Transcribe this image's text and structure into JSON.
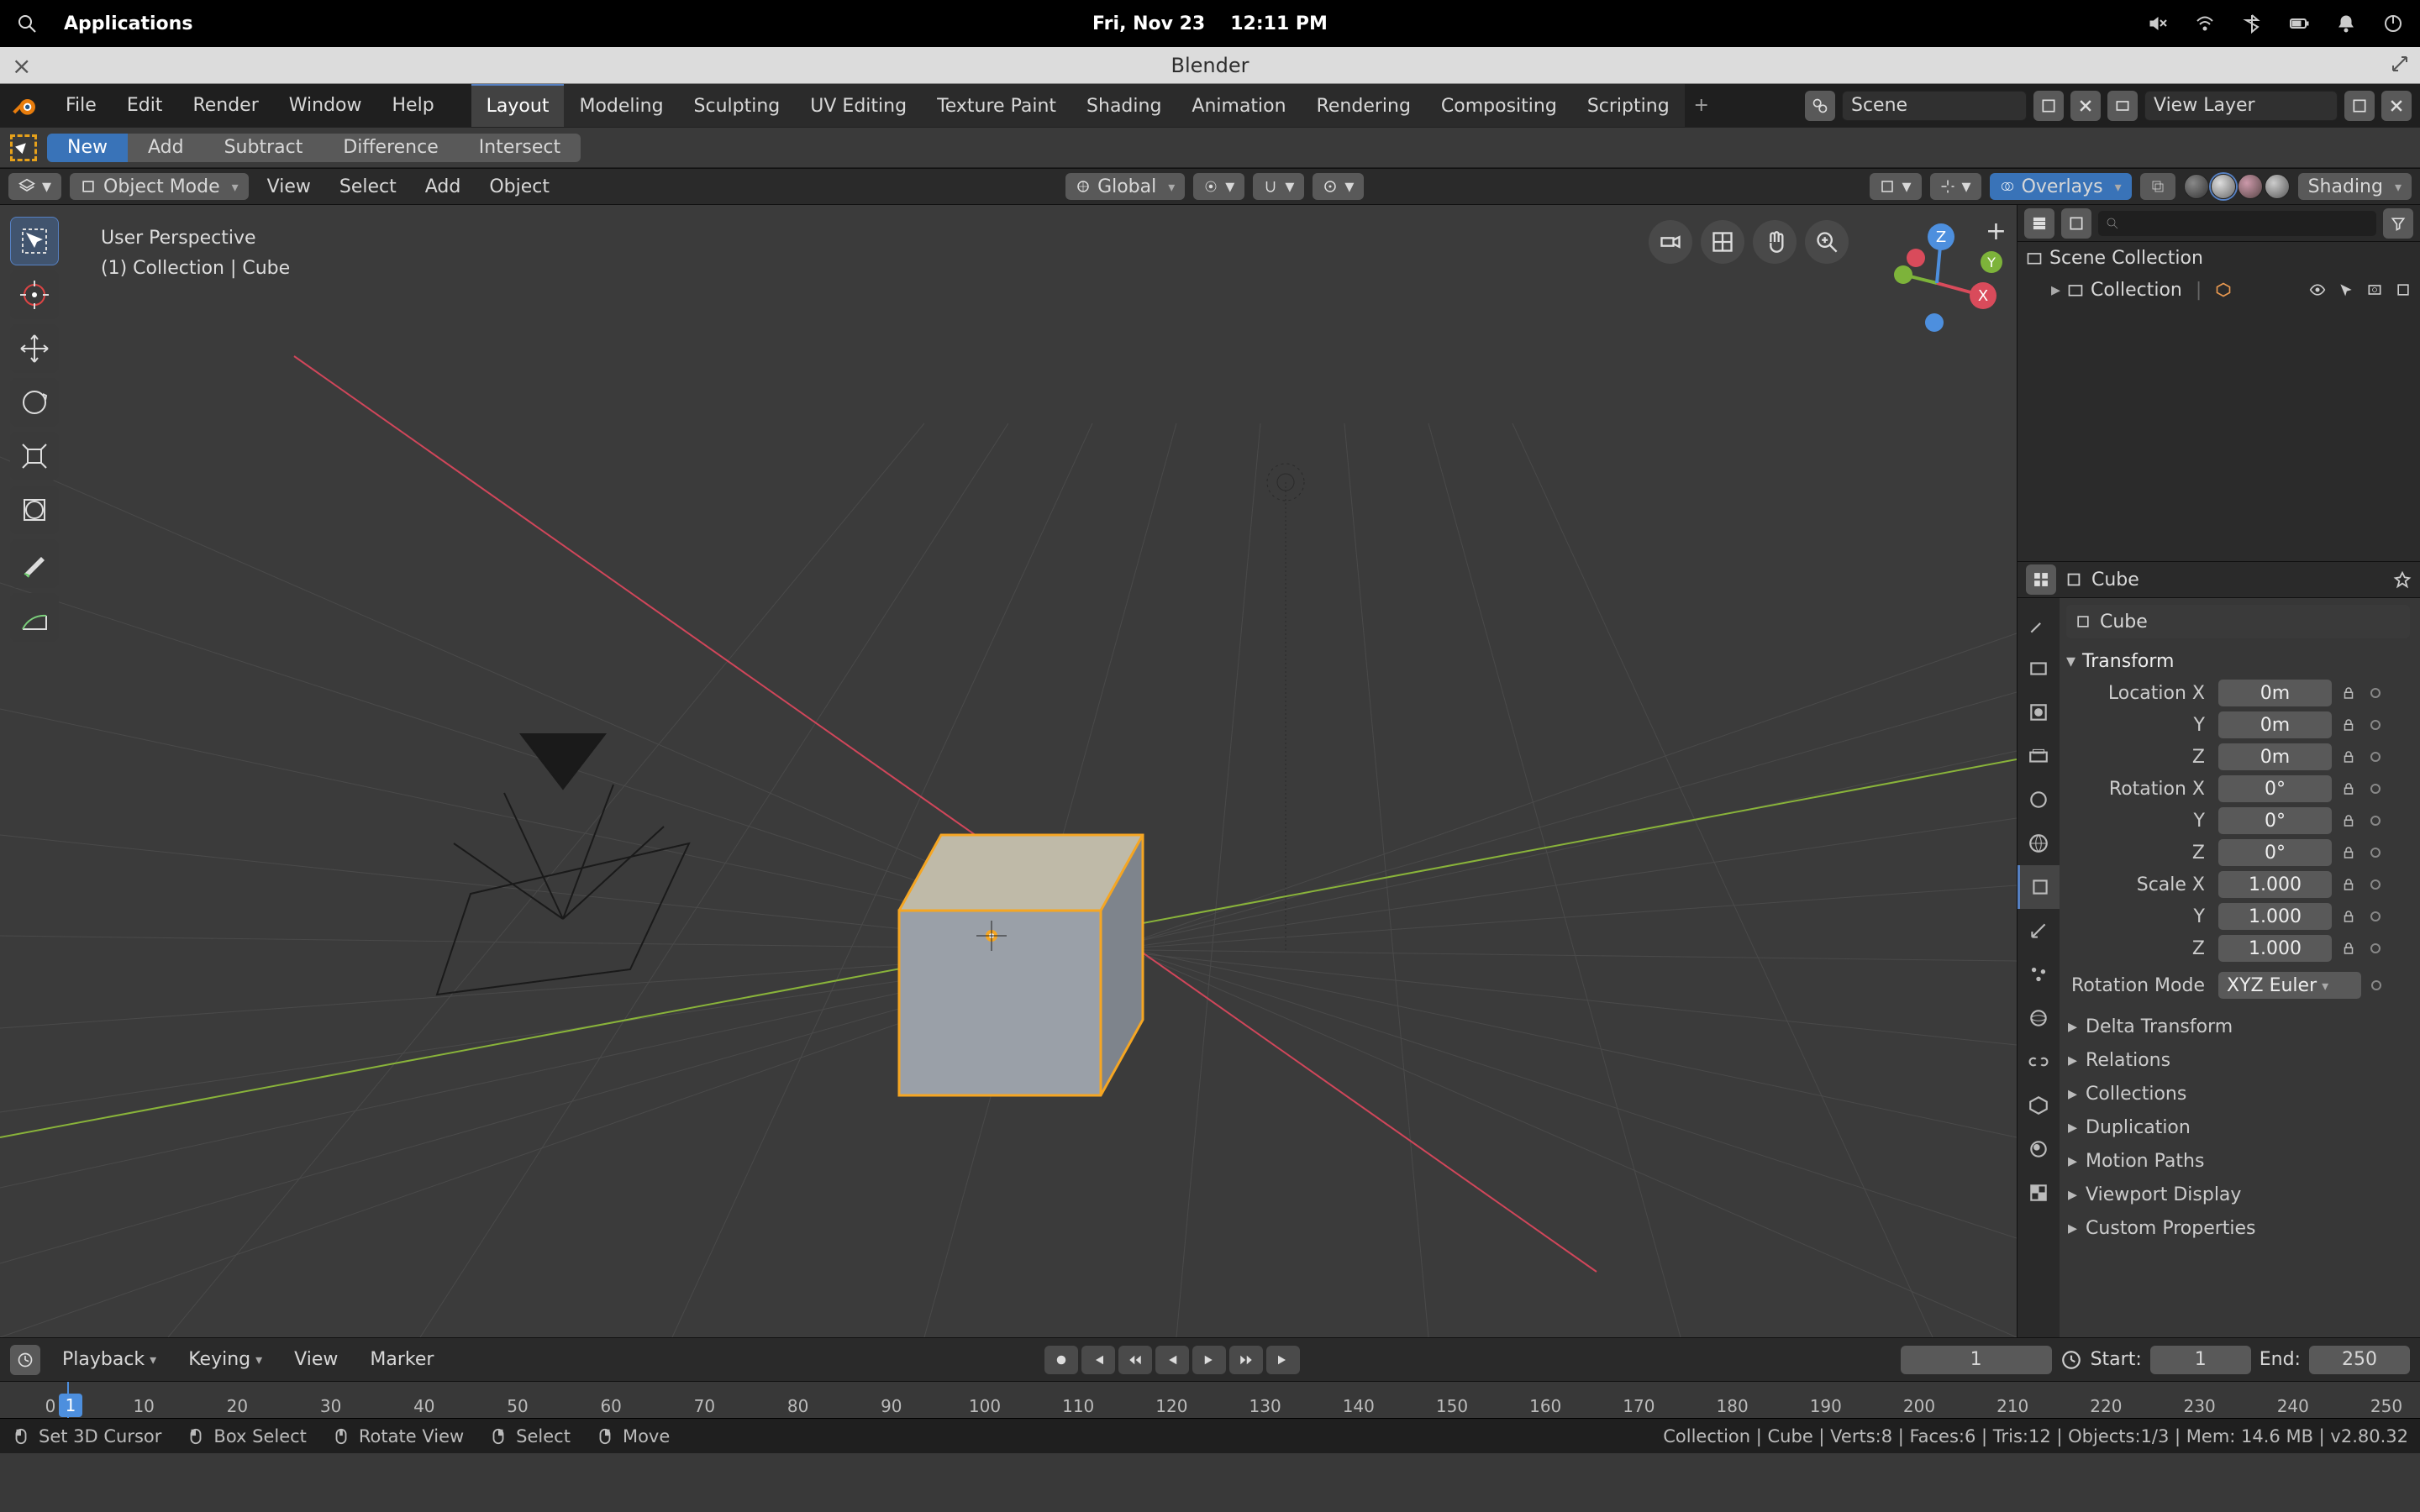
{
  "system_bar": {
    "applications_label": "Applications",
    "date": "Fri, Nov 23",
    "time": "12:11 PM"
  },
  "window": {
    "title": "Blender"
  },
  "main_menu": {
    "items": [
      "File",
      "Edit",
      "Render",
      "Window",
      "Help"
    ]
  },
  "workspaces": {
    "tabs": [
      "Layout",
      "Modeling",
      "Sculpting",
      "UV Editing",
      "Texture Paint",
      "Shading",
      "Animation",
      "Rendering",
      "Compositing",
      "Scripting"
    ],
    "active_index": 0
  },
  "scene_selector": {
    "scene": "Scene",
    "view_layer": "View Layer"
  },
  "tool_settings": {
    "mode_buttons": [
      "New",
      "Add",
      "Subtract",
      "Difference",
      "Intersect"
    ],
    "active_index": 0
  },
  "view3d_header": {
    "mode": "Object Mode",
    "menus": [
      "View",
      "Select",
      "Add",
      "Object"
    ],
    "orientation": "Global",
    "overlays": "Overlays",
    "shading": "Shading"
  },
  "view3d_overlay": {
    "line1": "User Perspective",
    "line2": "(1) Collection | Cube"
  },
  "axis_labels": {
    "x": "X",
    "y": "Y",
    "z": "Z"
  },
  "outliner": {
    "root": "Scene Collection",
    "items": [
      {
        "name": "Collection"
      }
    ]
  },
  "properties": {
    "breadcrumb": "Cube",
    "object_name": "Cube",
    "transform_label": "Transform",
    "rows": [
      {
        "label": "Location X",
        "value": "0m"
      },
      {
        "label": "Y",
        "value": "0m"
      },
      {
        "label": "Z",
        "value": "0m"
      },
      {
        "label": "Rotation X",
        "value": "0°"
      },
      {
        "label": "Y",
        "value": "0°"
      },
      {
        "label": "Z",
        "value": "0°"
      },
      {
        "label": "Scale X",
        "value": "1.000"
      },
      {
        "label": "Y",
        "value": "1.000"
      },
      {
        "label": "Z",
        "value": "1.000"
      }
    ],
    "rotation_mode_label": "Rotation Mode",
    "rotation_mode_value": "XYZ Euler",
    "collapsed_panels": [
      "Delta Transform",
      "Relations",
      "Collections",
      "Duplication",
      "Motion Paths",
      "Viewport Display",
      "Custom Properties"
    ]
  },
  "timeline": {
    "menus": [
      "Playback",
      "Keying",
      "View",
      "Marker"
    ],
    "current": "1",
    "start_label": "Start:",
    "start": "1",
    "end_label": "End:",
    "end": "250",
    "ticks": [
      0,
      10,
      20,
      30,
      40,
      50,
      60,
      70,
      80,
      90,
      100,
      110,
      120,
      130,
      140,
      150,
      160,
      170,
      180,
      190,
      200,
      210,
      220,
      230,
      240,
      250
    ]
  },
  "status_bar": {
    "hints": [
      {
        "text": "Set 3D Cursor"
      },
      {
        "text": "Box Select"
      },
      {
        "text": "Rotate View"
      },
      {
        "text": "Select"
      },
      {
        "text": "Move"
      }
    ],
    "right": "Collection | Cube | Verts:8 | Faces:6 | Tris:12 | Objects:1/3 | Mem: 14.6 MB | v2.80.32"
  }
}
